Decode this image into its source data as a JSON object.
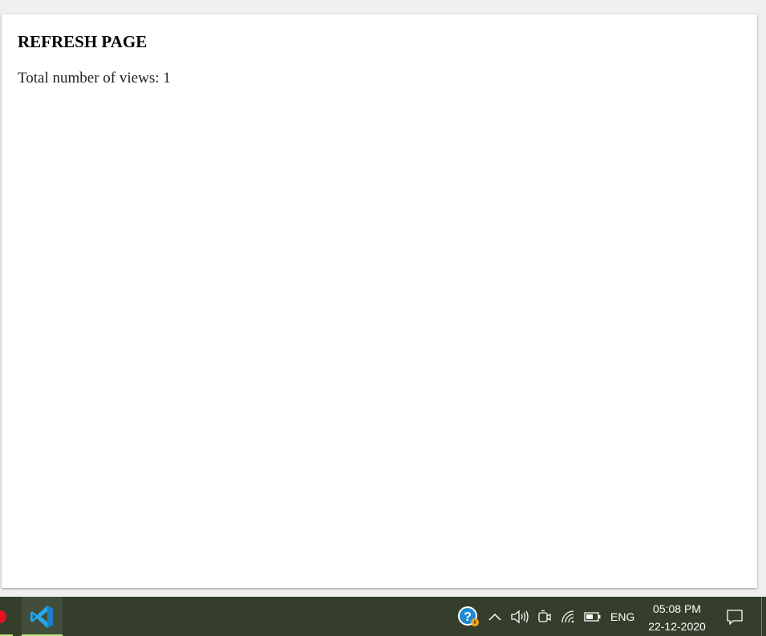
{
  "page": {
    "title": "REFRESH PAGE",
    "views_text": "Total number of views: 1"
  },
  "taskbar": {
    "pinned_apps": [
      {
        "name": "partial-app-icon",
        "active": true
      },
      {
        "name": "vscode-icon",
        "active": true
      }
    ],
    "tray": {
      "help_icon": "help-question-icon",
      "chevron_icon": "chevron-up-icon",
      "volume_icon": "speaker-icon",
      "meet_icon": "meet-now-icon",
      "wifi_icon": "wifi-icon",
      "battery_icon": "battery-icon",
      "language": "ENG"
    },
    "clock": {
      "time": "05:08 PM",
      "date": "22-12-2020"
    },
    "notification_icon": "action-center-icon"
  },
  "colors": {
    "taskbar_bg": "#343e2b",
    "active_underline": "#b7e07a",
    "vscode_blue": "#23a9f2"
  }
}
